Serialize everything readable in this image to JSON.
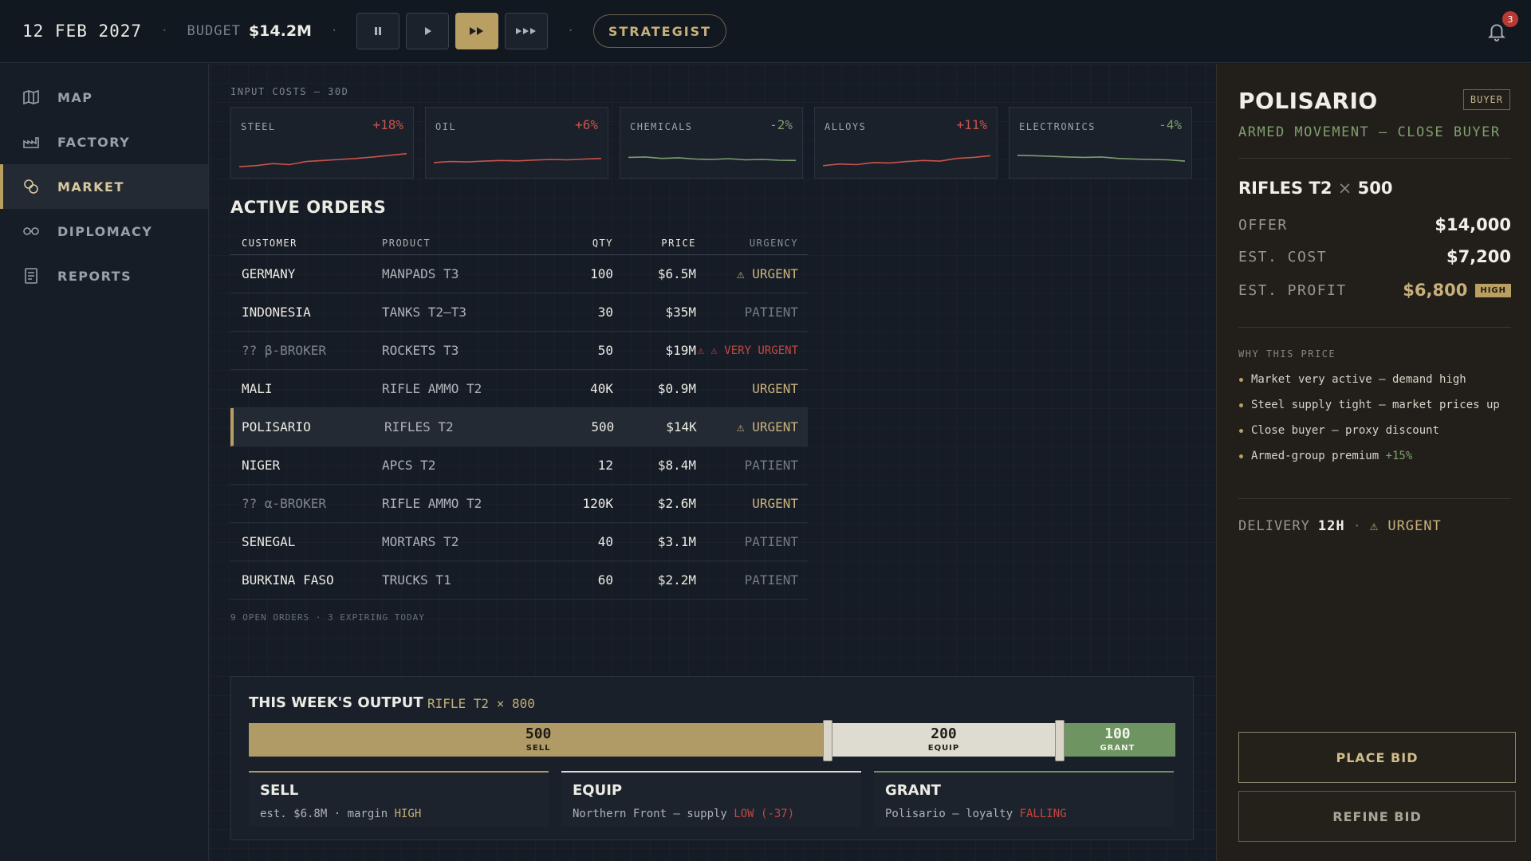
{
  "topbar": {
    "date": "12 FEB 2027",
    "budget_label": "BUDGET",
    "budget_value": "$14.2M",
    "role": "STRATEGIST",
    "notifications": "3"
  },
  "sidebar": {
    "items": [
      {
        "label": "MAP",
        "icon": "map-icon"
      },
      {
        "label": "FACTORY",
        "icon": "factory-icon"
      },
      {
        "label": "MARKET",
        "icon": "market-icon",
        "active": true
      },
      {
        "label": "DIPLOMACY",
        "icon": "diplomacy-icon"
      },
      {
        "label": "REPORTS",
        "icon": "reports-icon"
      }
    ]
  },
  "input_costs": {
    "caption": "INPUT COSTS — 30D",
    "items": [
      {
        "name": "STEEL",
        "delta": "+18%",
        "trend": [
          0.15,
          0.2,
          0.3,
          0.25,
          0.4,
          0.45,
          0.5,
          0.55,
          0.62,
          0.7,
          0.78
        ],
        "color": "#c9544a"
      },
      {
        "name": "OIL",
        "delta": "+6%",
        "trend": [
          0.35,
          0.4,
          0.38,
          0.42,
          0.45,
          0.43,
          0.47,
          0.5,
          0.48,
          0.52,
          0.55
        ],
        "color": "#c9544a"
      },
      {
        "name": "CHEMICALS",
        "delta": "-2%",
        "trend": [
          0.6,
          0.62,
          0.55,
          0.58,
          0.52,
          0.5,
          0.54,
          0.48,
          0.5,
          0.46,
          0.45
        ],
        "color": "#7e9d70"
      },
      {
        "name": "ALLOYS",
        "delta": "+11%",
        "trend": [
          0.2,
          0.28,
          0.25,
          0.35,
          0.33,
          0.4,
          0.45,
          0.42,
          0.55,
          0.6,
          0.68
        ],
        "color": "#c9544a"
      },
      {
        "name": "ELECTRONICS",
        "delta": "-4%",
        "trend": [
          0.7,
          0.68,
          0.65,
          0.62,
          0.6,
          0.62,
          0.55,
          0.52,
          0.5,
          0.48,
          0.42
        ],
        "color": "#7e9d70"
      }
    ]
  },
  "orders": {
    "title": "ACTIVE ORDERS",
    "headers": {
      "customer": "CUSTOMER",
      "product": "PRODUCT",
      "qty": "QTY",
      "price": "PRICE",
      "urgency": "URGENCY"
    },
    "rows": [
      {
        "customer": "GERMANY",
        "product": "MANPADS T3",
        "qty": "100",
        "price": "$6.5M",
        "urgency": "⚠ URGENT",
        "level": "urgent"
      },
      {
        "customer": "INDONESIA",
        "product": "TANKS T2–T3",
        "qty": "30",
        "price": "$35M",
        "urgency": "PATIENT",
        "level": "patient"
      },
      {
        "customer": "?? β-BROKER",
        "product": "ROCKETS T3",
        "qty": "50",
        "price": "$19M",
        "urgency": "⚠ ⚠ VERY URGENT",
        "level": "very",
        "broker": true
      },
      {
        "customer": "MALI",
        "product": "RIFLE AMMO T2",
        "qty": "40K",
        "price": "$0.9M",
        "urgency": "URGENT",
        "level": "urgent"
      },
      {
        "customer": "POLISARIO",
        "product": "RIFLES T2",
        "qty": "500",
        "price": "$14K",
        "urgency": "⚠ URGENT",
        "level": "urgent",
        "selected": true
      },
      {
        "customer": "NIGER",
        "product": "APCS T2",
        "qty": "12",
        "price": "$8.4M",
        "urgency": "PATIENT",
        "level": "patient"
      },
      {
        "customer": "?? α-BROKER",
        "product": "RIFLE AMMO T2",
        "qty": "120K",
        "price": "$2.6M",
        "urgency": "URGENT",
        "level": "urgent",
        "broker": true
      },
      {
        "customer": "SENEGAL",
        "product": "MORTARS T2",
        "qty": "40",
        "price": "$3.1M",
        "urgency": "PATIENT",
        "level": "patient"
      },
      {
        "customer": "BURKINA FASO",
        "product": "TRUCKS T1",
        "qty": "60",
        "price": "$2.2M",
        "urgency": "PATIENT",
        "level": "patient"
      }
    ],
    "footer": "9 OPEN ORDERS · 3 EXPIRING TODAY"
  },
  "output": {
    "title": "THIS WEEK'S OUTPUT",
    "subtitle": "RIFLE T2 × 800",
    "total": 800,
    "segments": [
      {
        "value": 500,
        "num": "500",
        "label": "SELL",
        "cls": "seg-sell"
      },
      {
        "value": 200,
        "num": "200",
        "label": "EQUIP",
        "cls": "seg-equip"
      },
      {
        "value": 100,
        "num": "100",
        "label": "GRANT",
        "cls": "seg-grant"
      }
    ],
    "cards": [
      {
        "title": "SELL",
        "desc_pre": "est. $6.8M · margin ",
        "desc_hl": "HIGH",
        "hl_cls": "hl-gold",
        "border": "#b09b66"
      },
      {
        "title": "EQUIP",
        "desc_pre": "Northern Front — supply ",
        "desc_hl": "LOW (-37)",
        "hl_cls": "hl-red",
        "border": "#dedbd0"
      },
      {
        "title": "GRANT",
        "desc_pre": "Polisario — loyalty ",
        "desc_hl": "FALLING",
        "hl_cls": "hl-red",
        "border": "#6e9461"
      }
    ]
  },
  "detail": {
    "name": "POLISARIO",
    "badge": "BUYER",
    "subtitle": "ARMED MOVEMENT — CLOSE BUYER",
    "product": "RIFLES T2",
    "times": "×",
    "quantity": "500",
    "offer_label": "OFFER",
    "offer_value": "$14,000",
    "cost_label": "EST. COST",
    "cost_value": "$7,200",
    "profit_label": "EST. PROFIT",
    "profit_value": "$6,800",
    "profit_badge": "HIGH",
    "why_label": "WHY THIS PRICE",
    "reasons": [
      {
        "text": "Market very active — demand high",
        "hl": ""
      },
      {
        "text": "Steel supply tight — market prices up",
        "hl": ""
      },
      {
        "text": "Close buyer — proxy discount",
        "hl": ""
      },
      {
        "text": "Armed-group premium ",
        "hl": "+15%"
      }
    ],
    "delivery_label": "DELIVERY",
    "delivery_value": "12H",
    "delivery_urgency": "⚠ URGENT",
    "place_bid": "PLACE BID",
    "refine_bid": "REFINE BID"
  },
  "colors": {
    "accent": "#b99f62",
    "danger": "#c5463e",
    "positive": "#7e9d70"
  }
}
